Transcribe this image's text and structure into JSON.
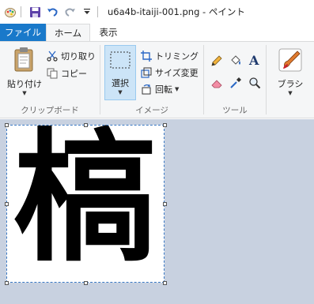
{
  "titlebar": {
    "title": "u6a4b-itaiji-001.png - ペイント",
    "icons": [
      "paint-app-icon",
      "save-icon",
      "undo-icon",
      "redo-icon",
      "customize-qat-icon"
    ]
  },
  "tabs": [
    {
      "label": "ファイル"
    },
    {
      "label": "ホーム"
    },
    {
      "label": "表示"
    }
  ],
  "ribbon": {
    "clipboard": {
      "paste_label": "貼り付け",
      "cut_label": "切り取り",
      "copy_label": "コピー",
      "group_label": "クリップボード"
    },
    "image": {
      "select_label": "選択",
      "crop_label": "トリミング",
      "resize_label": "サイズ変更",
      "rotate_label": "回転",
      "group_label": "イメージ"
    },
    "tools": {
      "group_label": "ツール"
    },
    "brushes": {
      "label": "ブラシ"
    }
  },
  "canvas": {
    "glyph": "槁"
  },
  "colors": {
    "file_tab": "#1979ca",
    "ribbon_bg": "#f5f6f7",
    "workspace_bg": "#c8d1e0",
    "selection": "#cce4f7"
  }
}
